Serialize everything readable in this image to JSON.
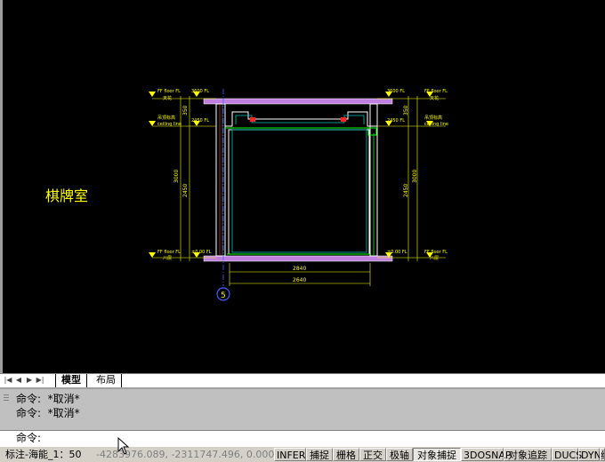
{
  "drawing": {
    "room_label": "棋牌室",
    "axis_bubble": "5",
    "top_dim_left": "3600 FL",
    "top_dim_right": "3600 FL",
    "ceiling_dim_left": "2450 FL",
    "ceiling_dim_right": "2450 FL",
    "floor_dim_left": "±0.00 FL",
    "floor_dim_right": "±0.00 FL",
    "left_mark_top": "FF floor FL",
    "left_mark_top_sub": "天花",
    "left_mark_mid": "吊顶标高",
    "left_mark_mid_sub": "ceiling line",
    "left_mark_bot": "FF floor FL",
    "left_mark_bot_sub": "八层",
    "right_mark_top": "FF floor FL",
    "right_mark_top_sub": "天花",
    "right_mark_mid": "吊顶标高",
    "right_mark_mid_sub": "ceiling line",
    "right_mark_bot": "FF floor FL",
    "right_mark_bot_sub": "八层",
    "vdim_left_upper": "350",
    "vdim_left_total": "3000",
    "vdim_left_lower": "2450",
    "vdim_right_upper": "350",
    "vdim_right_total": "3000",
    "vdim_right_lower": "2450",
    "hdim_inner": "2840",
    "hdim_outer": "2640"
  },
  "tabs": {
    "model": "模型",
    "layout": "布局"
  },
  "command": {
    "history": [
      "命令:  *取消*",
      "命令:  *取消*"
    ],
    "prompt": "命令:"
  },
  "status": {
    "annotation_scale": "标注-海能_1：50",
    "coords": "-4283976.089, -2311747.496, 0.000",
    "toggles": [
      {
        "label": "INFER",
        "on": false
      },
      {
        "label": "捕捉",
        "on": false
      },
      {
        "label": "栅格",
        "on": false
      },
      {
        "label": "正交",
        "on": false
      },
      {
        "label": "极轴",
        "on": false
      },
      {
        "label": "对象捕捉",
        "on": true
      },
      {
        "label": "3DOSNAP",
        "on": false
      },
      {
        "label": "对象追踪",
        "on": false
      },
      {
        "label": "DUCS",
        "on": false
      },
      {
        "label": "DYN",
        "on": false
      },
      {
        "label": "线",
        "on": false
      }
    ]
  },
  "colors": {
    "canvas_bg": "#000000",
    "dim_yellow": "#ffff00",
    "slab_magenta": "#c080e0",
    "wall_white": "#ffffff",
    "frame_green": "#00ff00",
    "cyan": "#00c0c0",
    "axis_blue": "#4060ff",
    "red_mark": "#ff2020"
  }
}
